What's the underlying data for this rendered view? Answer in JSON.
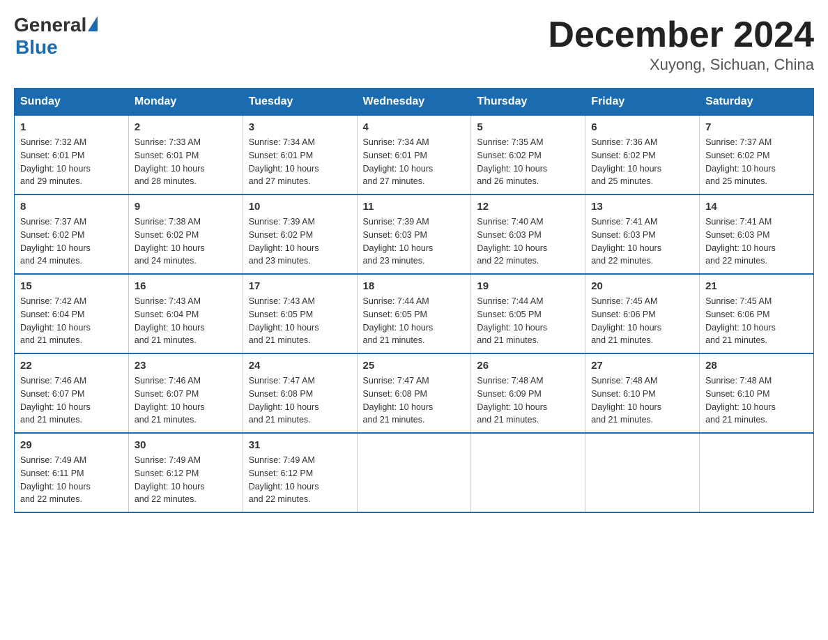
{
  "header": {
    "logo": {
      "general": "General",
      "blue": "Blue"
    },
    "title": "December 2024",
    "location": "Xuyong, Sichuan, China"
  },
  "weekdays": [
    "Sunday",
    "Monday",
    "Tuesday",
    "Wednesday",
    "Thursday",
    "Friday",
    "Saturday"
  ],
  "weeks": [
    [
      {
        "day": "1",
        "sunrise": "7:32 AM",
        "sunset": "6:01 PM",
        "daylight": "10 hours and 29 minutes."
      },
      {
        "day": "2",
        "sunrise": "7:33 AM",
        "sunset": "6:01 PM",
        "daylight": "10 hours and 28 minutes."
      },
      {
        "day": "3",
        "sunrise": "7:34 AM",
        "sunset": "6:01 PM",
        "daylight": "10 hours and 27 minutes."
      },
      {
        "day": "4",
        "sunrise": "7:34 AM",
        "sunset": "6:01 PM",
        "daylight": "10 hours and 27 minutes."
      },
      {
        "day": "5",
        "sunrise": "7:35 AM",
        "sunset": "6:02 PM",
        "daylight": "10 hours and 26 minutes."
      },
      {
        "day": "6",
        "sunrise": "7:36 AM",
        "sunset": "6:02 PM",
        "daylight": "10 hours and 25 minutes."
      },
      {
        "day": "7",
        "sunrise": "7:37 AM",
        "sunset": "6:02 PM",
        "daylight": "10 hours and 25 minutes."
      }
    ],
    [
      {
        "day": "8",
        "sunrise": "7:37 AM",
        "sunset": "6:02 PM",
        "daylight": "10 hours and 24 minutes."
      },
      {
        "day": "9",
        "sunrise": "7:38 AM",
        "sunset": "6:02 PM",
        "daylight": "10 hours and 24 minutes."
      },
      {
        "day": "10",
        "sunrise": "7:39 AM",
        "sunset": "6:02 PM",
        "daylight": "10 hours and 23 minutes."
      },
      {
        "day": "11",
        "sunrise": "7:39 AM",
        "sunset": "6:03 PM",
        "daylight": "10 hours and 23 minutes."
      },
      {
        "day": "12",
        "sunrise": "7:40 AM",
        "sunset": "6:03 PM",
        "daylight": "10 hours and 22 minutes."
      },
      {
        "day": "13",
        "sunrise": "7:41 AM",
        "sunset": "6:03 PM",
        "daylight": "10 hours and 22 minutes."
      },
      {
        "day": "14",
        "sunrise": "7:41 AM",
        "sunset": "6:03 PM",
        "daylight": "10 hours and 22 minutes."
      }
    ],
    [
      {
        "day": "15",
        "sunrise": "7:42 AM",
        "sunset": "6:04 PM",
        "daylight": "10 hours and 21 minutes."
      },
      {
        "day": "16",
        "sunrise": "7:43 AM",
        "sunset": "6:04 PM",
        "daylight": "10 hours and 21 minutes."
      },
      {
        "day": "17",
        "sunrise": "7:43 AM",
        "sunset": "6:05 PM",
        "daylight": "10 hours and 21 minutes."
      },
      {
        "day": "18",
        "sunrise": "7:44 AM",
        "sunset": "6:05 PM",
        "daylight": "10 hours and 21 minutes."
      },
      {
        "day": "19",
        "sunrise": "7:44 AM",
        "sunset": "6:05 PM",
        "daylight": "10 hours and 21 minutes."
      },
      {
        "day": "20",
        "sunrise": "7:45 AM",
        "sunset": "6:06 PM",
        "daylight": "10 hours and 21 minutes."
      },
      {
        "day": "21",
        "sunrise": "7:45 AM",
        "sunset": "6:06 PM",
        "daylight": "10 hours and 21 minutes."
      }
    ],
    [
      {
        "day": "22",
        "sunrise": "7:46 AM",
        "sunset": "6:07 PM",
        "daylight": "10 hours and 21 minutes."
      },
      {
        "day": "23",
        "sunrise": "7:46 AM",
        "sunset": "6:07 PM",
        "daylight": "10 hours and 21 minutes."
      },
      {
        "day": "24",
        "sunrise": "7:47 AM",
        "sunset": "6:08 PM",
        "daylight": "10 hours and 21 minutes."
      },
      {
        "day": "25",
        "sunrise": "7:47 AM",
        "sunset": "6:08 PM",
        "daylight": "10 hours and 21 minutes."
      },
      {
        "day": "26",
        "sunrise": "7:48 AM",
        "sunset": "6:09 PM",
        "daylight": "10 hours and 21 minutes."
      },
      {
        "day": "27",
        "sunrise": "7:48 AM",
        "sunset": "6:10 PM",
        "daylight": "10 hours and 21 minutes."
      },
      {
        "day": "28",
        "sunrise": "7:48 AM",
        "sunset": "6:10 PM",
        "daylight": "10 hours and 21 minutes."
      }
    ],
    [
      {
        "day": "29",
        "sunrise": "7:49 AM",
        "sunset": "6:11 PM",
        "daylight": "10 hours and 22 minutes."
      },
      {
        "day": "30",
        "sunrise": "7:49 AM",
        "sunset": "6:12 PM",
        "daylight": "10 hours and 22 minutes."
      },
      {
        "day": "31",
        "sunrise": "7:49 AM",
        "sunset": "6:12 PM",
        "daylight": "10 hours and 22 minutes."
      },
      null,
      null,
      null,
      null
    ]
  ],
  "labels": {
    "sunrise": "Sunrise:",
    "sunset": "Sunset:",
    "daylight": "Daylight:"
  }
}
